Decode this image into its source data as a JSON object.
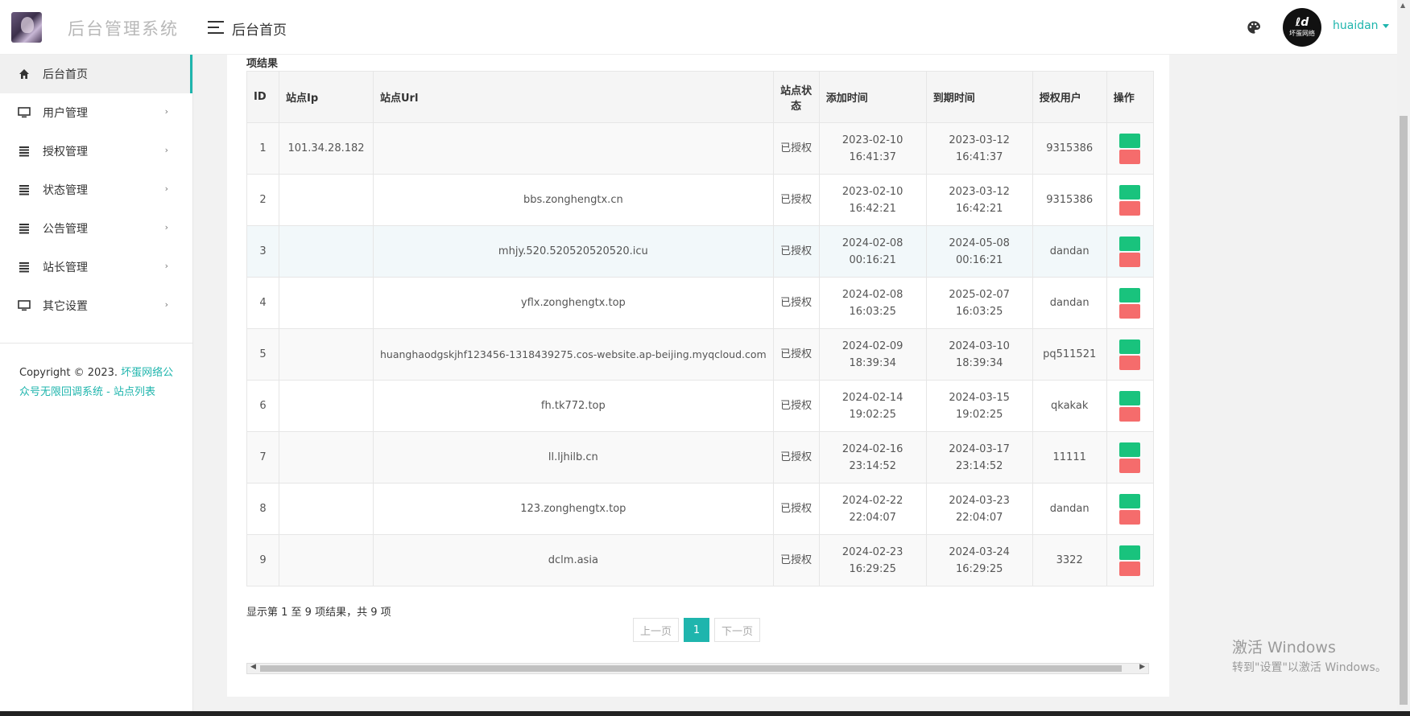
{
  "header": {
    "app_title": "后台管理系统",
    "page_title": "后台首页",
    "username": "huaidan",
    "avatar_text": "坏蛋网络"
  },
  "sidebar": {
    "items": [
      {
        "label": "后台首页",
        "icon": "home-icon"
      },
      {
        "label": "用户管理",
        "icon": "monitor-icon"
      },
      {
        "label": "授权管理",
        "icon": "list-icon"
      },
      {
        "label": "状态管理",
        "icon": "list-icon"
      },
      {
        "label": "公告管理",
        "icon": "list-icon"
      },
      {
        "label": "站长管理",
        "icon": "list-icon"
      },
      {
        "label": "其它设置",
        "icon": "monitor-icon"
      }
    ],
    "copyright_prefix": "Copyright © 2023. ",
    "copyright_link": "坏蛋网络公众号无限回调系统 - 站点列表"
  },
  "main": {
    "section_title": "项结果",
    "columns": [
      "ID",
      "站点Ip",
      "站点Url",
      "站点状态",
      "添加时间",
      "到期时间",
      "授权用户",
      "操作"
    ],
    "rows": [
      {
        "id": "1",
        "ip": "101.34.28.182",
        "url": "",
        "status": "已授权",
        "added": "2023-02-10 16:41:37",
        "expires": "2023-03-12 16:41:37",
        "user": "9315386"
      },
      {
        "id": "2",
        "ip": "",
        "url": "bbs.zonghengtx.cn",
        "status": "已授权",
        "added": "2023-02-10 16:42:21",
        "expires": "2023-03-12 16:42:21",
        "user": "9315386"
      },
      {
        "id": "3",
        "ip": "",
        "url": "mhjy.520.520520520520.icu",
        "status": "已授权",
        "added": "2024-02-08 00:16:21",
        "expires": "2024-05-08 00:16:21",
        "user": "dandan"
      },
      {
        "id": "4",
        "ip": "",
        "url": "yflx.zonghengtx.top",
        "status": "已授权",
        "added": "2024-02-08 16:03:25",
        "expires": "2025-02-07 16:03:25",
        "user": "dandan"
      },
      {
        "id": "5",
        "ip": "",
        "url": "huanghaodgskjhf123456-1318439275.cos-website.ap-beijing.myqcloud.com",
        "status": "已授权",
        "added": "2024-02-09 18:39:34",
        "expires": "2024-03-10 18:39:34",
        "user": "pq511521"
      },
      {
        "id": "6",
        "ip": "",
        "url": "fh.tk772.top",
        "status": "已授权",
        "added": "2024-02-14 19:02:25",
        "expires": "2024-03-15 19:02:25",
        "user": "qkakak"
      },
      {
        "id": "7",
        "ip": "",
        "url": "ll.ljhilb.cn",
        "status": "已授权",
        "added": "2024-02-16 23:14:52",
        "expires": "2024-03-17 23:14:52",
        "user": "11111"
      },
      {
        "id": "8",
        "ip": "",
        "url": "123.zonghengtx.top",
        "status": "已授权",
        "added": "2024-02-22 22:04:07",
        "expires": "2024-03-23 22:04:07",
        "user": "dandan"
      },
      {
        "id": "9",
        "ip": "",
        "url": "dclm.asia",
        "status": "已授权",
        "added": "2024-02-23 16:29:25",
        "expires": "2024-03-24 16:29:25",
        "user": "3322"
      }
    ],
    "info": "显示第 1 至 9 项结果，共 9 项",
    "pagination": {
      "prev": "上一页",
      "current": "1",
      "next": "下一页"
    }
  },
  "watermark": {
    "line1": "激活 Windows",
    "line2": "转到\"设置\"以激活 Windows。"
  },
  "colors": {
    "accent": "#1fb5ad",
    "approve_button": "#19c37d",
    "delete_button": "#f56c6c"
  }
}
